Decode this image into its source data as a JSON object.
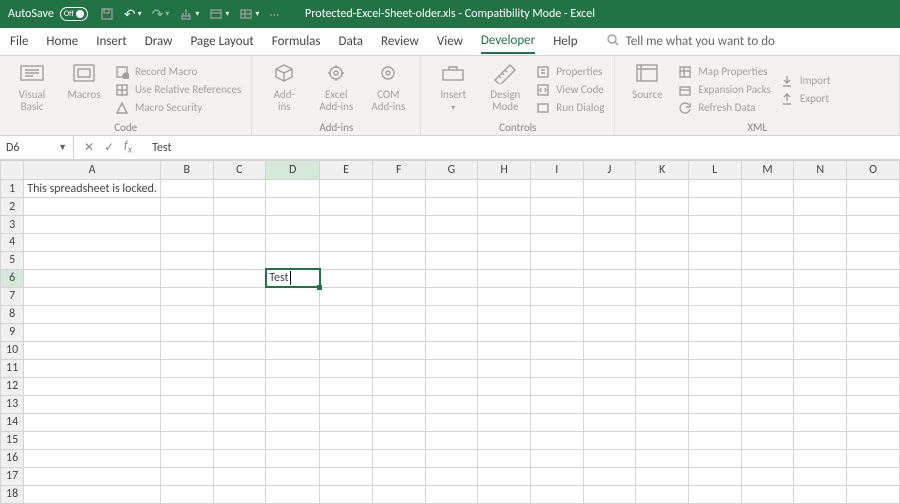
{
  "title": "Protected-Excel-Sheet-older.xls  -  Compatibility Mode  -  Excel",
  "autosave": {
    "label": "AutoSave",
    "state": "Off"
  },
  "tabs": [
    "File",
    "Home",
    "Insert",
    "Draw",
    "Page Layout",
    "Formulas",
    "Data",
    "Review",
    "View",
    "Developer",
    "Help"
  ],
  "active_tab": "Developer",
  "tell_me": "Tell me what you want to do",
  "ribbon": {
    "code": {
      "label": "Code",
      "visual_basic": "Visual\nBasic",
      "macros": "Macros",
      "record": "Record Macro",
      "relative": "Use Relative References",
      "security": "Macro Security"
    },
    "addins": {
      "label": "Add-ins",
      "addins": "Add-\nins",
      "excel": "Excel\nAdd-ins",
      "com": "COM\nAdd-ins"
    },
    "controls": {
      "label": "Controls",
      "insert": "Insert",
      "design": "Design\nMode",
      "properties": "Properties",
      "view_code": "View Code",
      "run_dialog": "Run Dialog"
    },
    "xml": {
      "label": "XML",
      "source": "Source",
      "map": "Map Properties",
      "expansion": "Expansion Packs",
      "refresh": "Refresh Data",
      "import": "Import",
      "export": "Export"
    }
  },
  "namebox": "D6",
  "formula_value": "Test",
  "columns": [
    "A",
    "B",
    "C",
    "D",
    "E",
    "F",
    "G",
    "H",
    "I",
    "J",
    "K",
    "L",
    "M",
    "N",
    "O"
  ],
  "rows": 18,
  "selected": {
    "col": "D",
    "row": 6
  },
  "cells": {
    "A1": "This spreadsheet is locked.",
    "D6": "Test"
  }
}
